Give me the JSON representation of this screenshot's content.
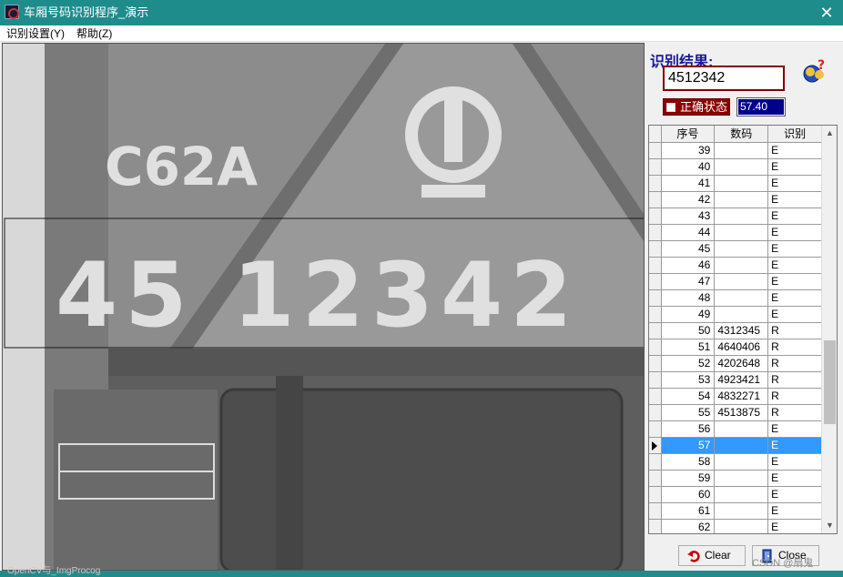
{
  "window": {
    "title": "车厢号码识别程序_演示"
  },
  "menu": [
    "识别设置(Y)",
    "帮助(Z)"
  ],
  "result": {
    "label": "识别结果:",
    "value": "4512342",
    "status_label": "正确状态",
    "score": "57.40"
  },
  "grid": {
    "columns": [
      "序号",
      "数码",
      "识别"
    ],
    "rows": [
      [
        "39",
        "",
        "E"
      ],
      [
        "40",
        "",
        "E"
      ],
      [
        "41",
        "",
        "E"
      ],
      [
        "42",
        "",
        "E"
      ],
      [
        "43",
        "",
        "E"
      ],
      [
        "44",
        "",
        "E"
      ],
      [
        "45",
        "",
        "E"
      ],
      [
        "46",
        "",
        "E"
      ],
      [
        "47",
        "",
        "E"
      ],
      [
        "48",
        "",
        "E"
      ],
      [
        "49",
        "",
        "E"
      ],
      [
        "50",
        "4312345",
        "R"
      ],
      [
        "51",
        "4640406",
        "R"
      ],
      [
        "52",
        "4202648",
        "R"
      ],
      [
        "53",
        "4923421",
        "R"
      ],
      [
        "54",
        "4832271",
        "R"
      ],
      [
        "55",
        "4513875",
        "R"
      ],
      [
        "56",
        "",
        "E"
      ],
      [
        "57",
        "",
        "E"
      ],
      [
        "58",
        "",
        "E"
      ],
      [
        "59",
        "",
        "E"
      ],
      [
        "60",
        "",
        "E"
      ],
      [
        "61",
        "",
        "E"
      ],
      [
        "62",
        "",
        "E"
      ]
    ],
    "selected": "57"
  },
  "buttons": {
    "clear": "Clear",
    "close": "Close"
  },
  "watermark": "CSDN @扇鬼",
  "image_caption": "OpenCV与_ImgProcog",
  "image_text": {
    "model": "C62A",
    "car_number": "45 12342"
  },
  "colors": {
    "titlebar": "#1f8c8c",
    "result_border": "#800000",
    "status_bg": "#8b0000",
    "score_bg": "#00008b",
    "selection": "#3399ff"
  }
}
